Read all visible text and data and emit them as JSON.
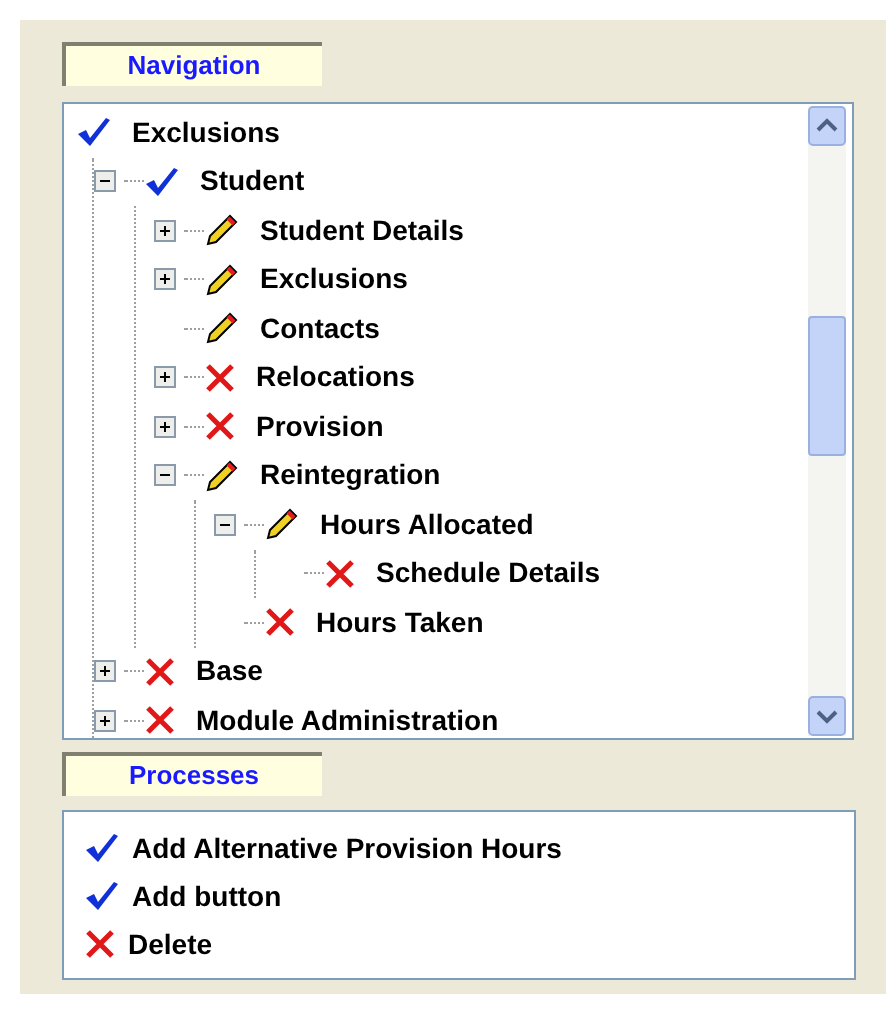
{
  "navigation": {
    "title": "Navigation",
    "tree": [
      {
        "label": "Exclusions",
        "kind": "check",
        "children": [
          {
            "label": "Student",
            "kind": "check",
            "expanded": true,
            "children": [
              {
                "label": "Student Details",
                "kind": "pencil",
                "expanded": false
              },
              {
                "label": "Exclusions",
                "kind": "pencil",
                "expanded": false
              },
              {
                "label": "Contacts",
                "kind": "pencil"
              },
              {
                "label": "Relocations",
                "kind": "cross",
                "expanded": false
              },
              {
                "label": "Provision",
                "kind": "cross",
                "expanded": false
              },
              {
                "label": "Reintegration",
                "kind": "pencil",
                "expanded": true,
                "children": [
                  {
                    "label": "Hours Allocated",
                    "kind": "pencil",
                    "expanded": true,
                    "children": [
                      {
                        "label": "Schedule Details",
                        "kind": "cross"
                      }
                    ]
                  },
                  {
                    "label": "Hours Taken",
                    "kind": "cross"
                  }
                ]
              }
            ]
          },
          {
            "label": "Base",
            "kind": "cross",
            "expanded": false
          },
          {
            "label": "Module Administration",
            "kind": "cross",
            "expanded": false
          }
        ]
      }
    ]
  },
  "processes": {
    "title": "Processes",
    "items": [
      {
        "label": "Add Alternative Provision Hours",
        "kind": "check"
      },
      {
        "label": "Add button",
        "kind": "check"
      },
      {
        "label": "Delete",
        "kind": "cross"
      }
    ]
  }
}
